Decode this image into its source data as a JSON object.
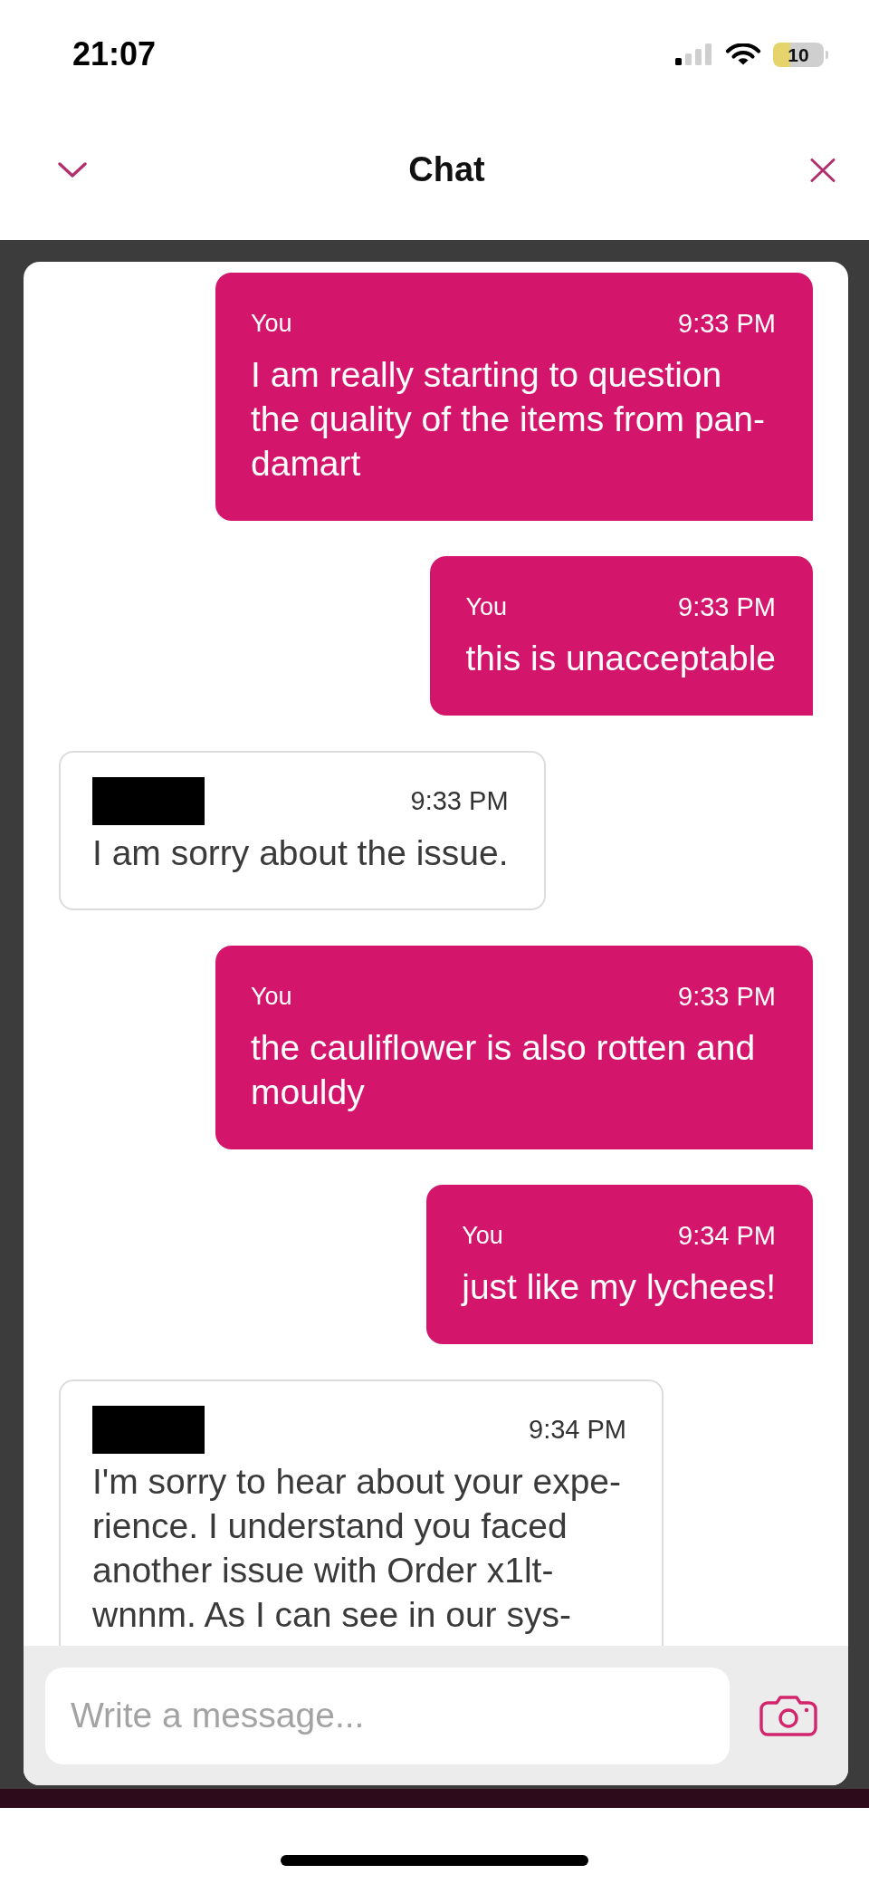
{
  "status_bar": {
    "time": "21:07",
    "battery_percent": "10"
  },
  "header": {
    "title": "Chat"
  },
  "messages": [
    {
      "kind": "outgoing",
      "sender": "You",
      "time": "9:33 PM",
      "text": "I am really starting to question the quality of the items from pan-damart",
      "cut_off": false
    },
    {
      "kind": "outgoing",
      "sender": "You",
      "time": "9:33 PM",
      "text": "this is unacceptable",
      "cut_off": false
    },
    {
      "kind": "incoming",
      "sender_redacted": true,
      "time": "9:33 PM",
      "text": "I am sorry about the issue.",
      "cut_off": false
    },
    {
      "kind": "outgoing",
      "sender": "You",
      "time": "9:33 PM",
      "text": "the cauliflower is also rotten and mouldy",
      "cut_off": false
    },
    {
      "kind": "outgoing",
      "sender": "You",
      "time": "9:34 PM",
      "text": "just like my lychees!",
      "cut_off": false
    },
    {
      "kind": "incoming",
      "sender_redacted": true,
      "time": "9:34 PM",
      "text": "I'm sorry to hear about your expe-rience. I understand you faced another issue with Order x1lt-wnnm. As I can see in our sys-",
      "cut_off": true
    }
  ],
  "composer": {
    "placeholder": "Write a message..."
  }
}
